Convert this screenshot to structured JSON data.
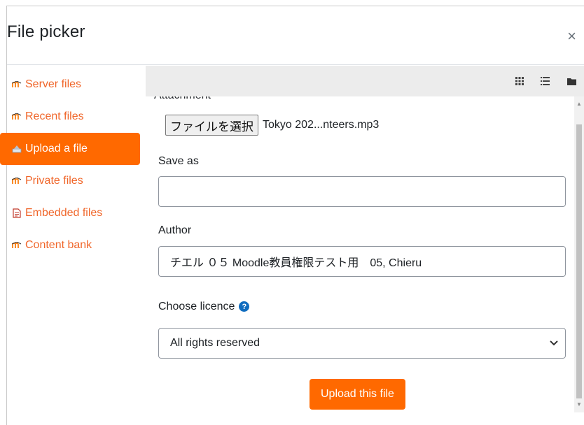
{
  "dialog": {
    "title": "File picker",
    "close_glyph": "×"
  },
  "sidebar": {
    "items": [
      {
        "label": "Server files",
        "icon": "moodle-icon"
      },
      {
        "label": "Recent files",
        "icon": "moodle-icon"
      },
      {
        "label": "Upload a file",
        "icon": "upload-icon",
        "active": true
      },
      {
        "label": "Private files",
        "icon": "moodle-icon"
      },
      {
        "label": "Embedded files",
        "icon": "document-icon"
      },
      {
        "label": "Content bank",
        "icon": "moodle-icon"
      }
    ]
  },
  "toolbar": {
    "view_icons": [
      "grid-view-icon",
      "list-view-icon",
      "folder-view-icon"
    ]
  },
  "upload_form": {
    "attachment_label": "Attachment",
    "choose_file_label": "ファイルを選択",
    "chosen_file_name": "Tokyo 202...nteers.mp3",
    "save_as_label": "Save as",
    "save_as_value": "",
    "author_label": "Author",
    "author_value": "チエル ０５ Moodle教員権限テスト用　05, Chieru",
    "licence_label": "Choose licence",
    "licence_value": "All rights reserved",
    "submit_label": "Upload this file"
  },
  "colors": {
    "accent": "#ff6900",
    "link": "#f0662a",
    "help": "#0f6cbf",
    "toolbar_bg": "#ececec"
  }
}
